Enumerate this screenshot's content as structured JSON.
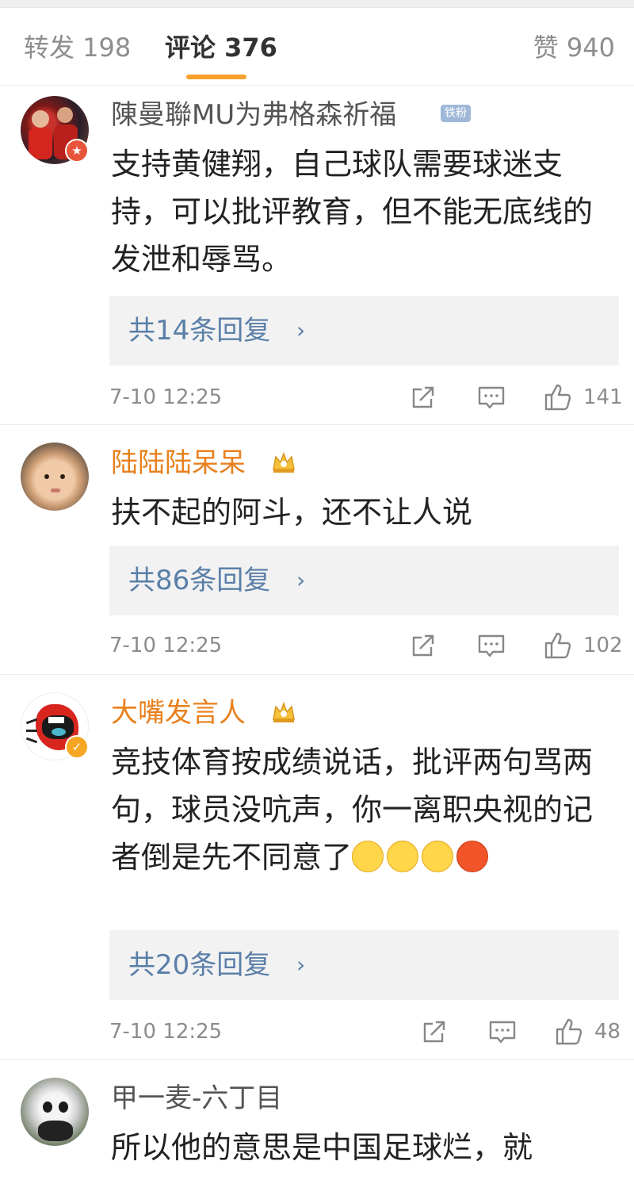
{
  "tabs": {
    "repost": "转发 198",
    "comments": "评论 376",
    "likes": "赞 940"
  },
  "accent_color": "#f7a12a",
  "comments": [
    {
      "username": "陳曼聯MU为弗格森祈福",
      "badge": "铁粉",
      "text": "支持黄健翔，自己球队需要球迷支持，可以批评教育，但不能无底线的发泄和辱骂。",
      "replies": "共14条回复",
      "time": "7-10 12:25",
      "likes": "141"
    },
    {
      "username": "陆陆陆呆呆",
      "text": "扶不起的阿斗，还不让人说",
      "replies": "共86条回复",
      "time": "7-10 12:25",
      "likes": "102"
    },
    {
      "username": "大嘴发言人",
      "text": "竞技体育按成绩说话，批评两句骂两句，球员没吭声，你一离职央视的记者倒是先不同意了",
      "replies": "共20条回复",
      "time": "7-10 12:25",
      "likes": "48"
    },
    {
      "username": "甲一麦-六丁目",
      "text": "所以他的意思是中国足球烂，就"
    }
  ],
  "icons": {
    "repost": "share-icon",
    "reply": "comment-icon",
    "like": "thumbs-up-icon",
    "chevron": "chevron-right-icon",
    "vip": "crown-icon"
  }
}
